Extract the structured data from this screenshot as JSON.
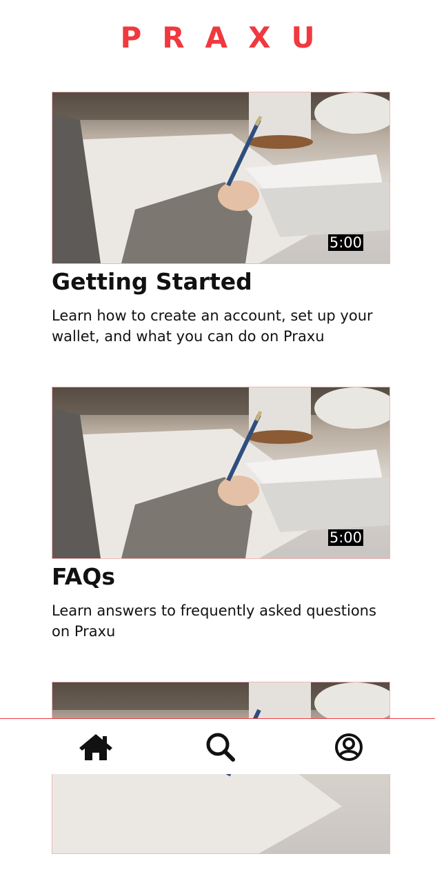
{
  "app": {
    "brand": "PRAXU",
    "brand_color": "#f0393f"
  },
  "cards": [
    {
      "title": "Getting Started",
      "description": "Learn how to create an account, set up your wallet, and what you can do on Praxu",
      "duration": "5:00",
      "thumbnail_icon": "writing-desk-photo"
    },
    {
      "title": "FAQs",
      "description": "Learn answers to frequently asked questions on Praxu",
      "duration": "5:00",
      "thumbnail_icon": "writing-desk-photo"
    },
    {
      "thumbnail_icon": "writing-desk-photo"
    }
  ],
  "nav": {
    "items": [
      {
        "icon": "home-icon"
      },
      {
        "icon": "search-icon"
      },
      {
        "icon": "account-icon"
      }
    ]
  }
}
